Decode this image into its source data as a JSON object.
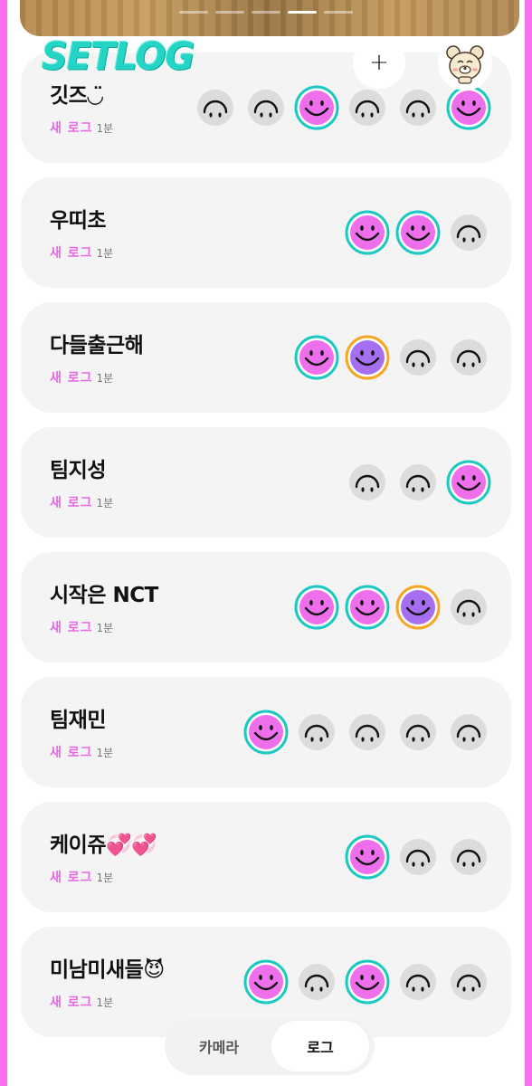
{
  "app": {
    "logo": "SETLOG"
  },
  "header": {
    "add_label": "+"
  },
  "pager": {
    "count": 5,
    "active_index": 3
  },
  "colors": {
    "pink_face": "#ee6fec",
    "purple_face": "#a66ef0",
    "teal_ring": "#1bc9c2",
    "orange_ring": "#f5a623",
    "empty_face": "#dcdcdc",
    "new_label": "#e668e4"
  },
  "logs": [
    {
      "title": "깃즈◡̈",
      "new_label": "새 로그",
      "time": "1분",
      "faces": [
        "empty",
        "empty",
        "pink",
        "empty",
        "empty",
        "pink"
      ]
    },
    {
      "title": "우띠초",
      "new_label": "새 로그",
      "time": "1분",
      "faces": [
        "pink",
        "pink",
        "empty"
      ]
    },
    {
      "title": "다들출근해",
      "new_label": "새 로그",
      "time": "1분",
      "faces": [
        "pink",
        "purple",
        "empty",
        "empty"
      ]
    },
    {
      "title": "팀지성",
      "new_label": "새 로그",
      "time": "1분",
      "faces": [
        "empty",
        "empty",
        "pink"
      ]
    },
    {
      "title": "시작은 NCT",
      "new_label": "새 로그",
      "time": "1분",
      "faces": [
        "pink",
        "pink",
        "purple",
        "empty"
      ]
    },
    {
      "title": "팀재민",
      "new_label": "새 로그",
      "time": "1분",
      "faces": [
        "pink",
        "empty",
        "empty",
        "empty",
        "empty"
      ]
    },
    {
      "title": "케이쥬💞💞",
      "new_label": "새 로그",
      "time": "1분",
      "faces": [
        "pink",
        "empty",
        "empty"
      ]
    },
    {
      "title": "미남미새들😈",
      "new_label": "새 로그",
      "time": "1분",
      "faces": [
        "pink",
        "empty",
        "pink",
        "empty",
        "empty"
      ]
    }
  ],
  "tabs": {
    "camera": "카메라",
    "log": "로그"
  }
}
